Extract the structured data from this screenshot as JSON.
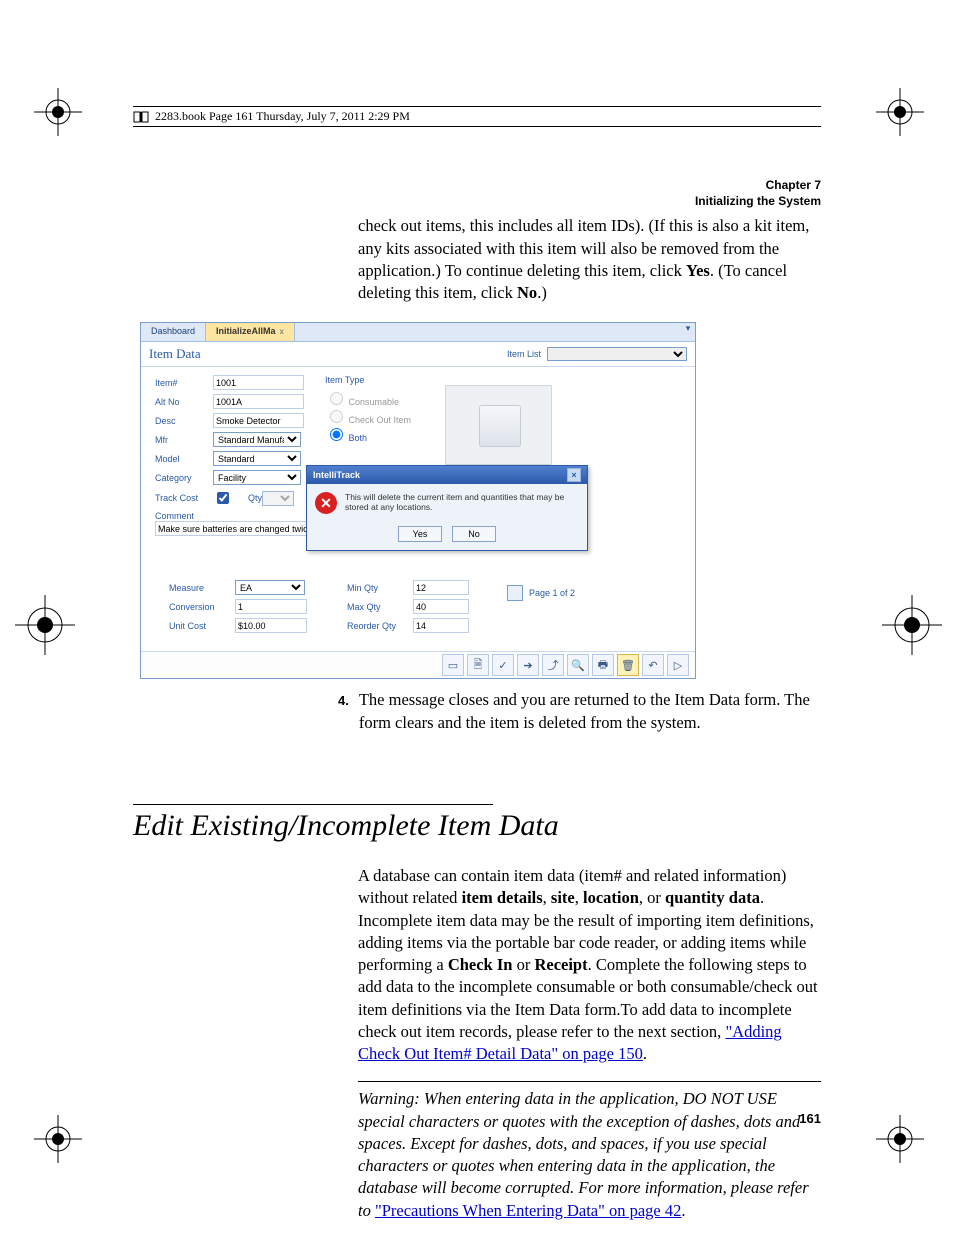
{
  "book_header": "2283.book  Page 161  Thursday, July 7, 2011  2:29 PM",
  "chapter": {
    "label": "Chapter 7",
    "title": "Initializing the System"
  },
  "para1_a": "check out items, this includes all item IDs). (If this is also a kit item, any kits associated with this item will also be removed from the appli­cation.) To continue deleting this item, click ",
  "para1_b": "Yes",
  "para1_c": ". (To cancel deleting this item, click ",
  "para1_d": "No",
  "para1_e": ".)",
  "step4_num": "4.",
  "step4_text": "The message closes and you are returned to the Item Data form. The form clears and the item is deleted from the system.",
  "section_title": "Edit Existing/Incomplete Item Data",
  "para2_a": "A database can contain item data (item# and related information) without related ",
  "para2_b": "item details",
  "para2_c": ", ",
  "para2_d": "site",
  "para2_e": ", ",
  "para2_f": "location",
  "para2_g": ", or ",
  "para2_h": "quantity data",
  "para2_i": ". Incomplete item data may be the result of importing item definitions, adding items via the porta­ble bar code reader, or adding items while performing a ",
  "para2_j": "Check In",
  "para2_k": " or ",
  "para2_l": "Receipt",
  "para2_m": ". Complete the following steps to add data to the incomplete con­sumable or both consumable/check out item definitions via the Item Data form.To add data to incomplete check out item records, please refer to the next section, ",
  "para2_link": "\"Adding Check Out Item# Detail Data\" on page 150",
  "para2_n": ".",
  "warning_a": "Warning:   When entering data in the application, DO NOT USE special characters or quotes with the exception of dashes, dots and spaces. Except for dashes, dots, and spaces, if you use special characters or quotes when entering data in the application, the database will become corrupted. For more information, please refer to ",
  "warning_link": "\"Precautions When Entering Data\" on page 42",
  "warning_b": ".",
  "page_number": "161",
  "app": {
    "tabs": {
      "dashboard": "Dashboard",
      "active": "InitializeAllMa",
      "close_x": "x"
    },
    "form_title": "Item Data",
    "item_list_label": "Item List",
    "labels": {
      "item": "Item#",
      "alt": "Alt No",
      "desc": "Desc",
      "mfr": "Mfr",
      "model": "Model",
      "category": "Category",
      "track": "Track Cost",
      "qty": "Qty",
      "comment": "Comment",
      "itemtype": "Item Type",
      "consumable": "Consumable",
      "checkout": "Check Out Item",
      "both": "Both",
      "measure": "Measure",
      "conversion": "Conversion",
      "unitcost": "Unit Cost",
      "minqty": "Min Qty",
      "maxqty": "Max Qty",
      "reorderqty": "Reorder Qty"
    },
    "values": {
      "item": "1001",
      "alt": "1001A",
      "desc": "Smoke Detector",
      "mfr": "Standard Manufacturin",
      "model": "Standard",
      "category": "Facility",
      "comment": "Make sure batteries are changed twice a",
      "measure": "EA",
      "conversion": "1",
      "unitcost": "$10.00",
      "minqty": "12",
      "maxqty": "40",
      "reorderqty": "14"
    },
    "pager": "Page 1 of 2",
    "dialog": {
      "title": "IntelliTrack",
      "message": "This will delete the current item and quantities that may be stored at any locations.",
      "yes": "Yes",
      "no": "No"
    },
    "toolbar_icons": [
      "▭",
      "🗎",
      "✓",
      "➔",
      "⤴",
      "🔍",
      "🖶",
      "🗑",
      "↶",
      "▷"
    ]
  }
}
